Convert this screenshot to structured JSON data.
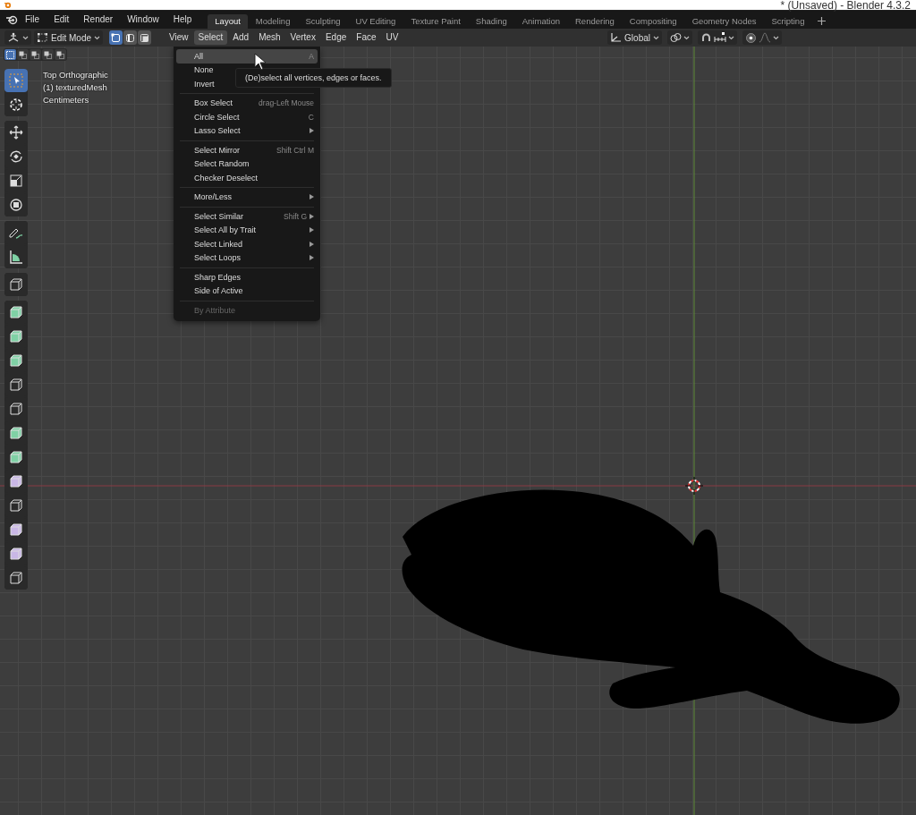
{
  "window": {
    "title": "* (Unsaved) - Blender 4.3.2"
  },
  "menubar": [
    "File",
    "Edit",
    "Render",
    "Window",
    "Help"
  ],
  "workspaces": [
    {
      "label": "Layout",
      "selected": true
    },
    {
      "label": "Modeling",
      "selected": false
    },
    {
      "label": "Sculpting",
      "selected": false
    },
    {
      "label": "UV Editing",
      "selected": false
    },
    {
      "label": "Texture Paint",
      "selected": false
    },
    {
      "label": "Shading",
      "selected": false
    },
    {
      "label": "Animation",
      "selected": false
    },
    {
      "label": "Rendering",
      "selected": false
    },
    {
      "label": "Compositing",
      "selected": false
    },
    {
      "label": "Geometry Nodes",
      "selected": false
    },
    {
      "label": "Scripting",
      "selected": false
    }
  ],
  "header": {
    "mode": "Edit Mode",
    "select_modes": [
      {
        "kind": "vertex",
        "selected": true
      },
      {
        "kind": "edge",
        "selected": false
      },
      {
        "kind": "face",
        "selected": false
      }
    ],
    "menus": [
      {
        "label": "View",
        "selected": false
      },
      {
        "label": "Select",
        "selected": true
      },
      {
        "label": "Add",
        "selected": false
      },
      {
        "label": "Mesh",
        "selected": false
      },
      {
        "label": "Vertex",
        "selected": false
      },
      {
        "label": "Edge",
        "selected": false
      },
      {
        "label": "Face",
        "selected": false
      },
      {
        "label": "UV",
        "selected": false
      }
    ],
    "orientation": "Global"
  },
  "viewport": {
    "overlay": [
      "Top Orthographic",
      "(1) texturedMesh",
      "Centimeters"
    ],
    "box_modes": [
      {
        "kind": "new",
        "selected": true
      },
      {
        "kind": "extend",
        "selected": false
      },
      {
        "kind": "subtract",
        "selected": false
      },
      {
        "kind": "invert",
        "selected": false
      },
      {
        "kind": "intersect",
        "selected": false
      }
    ],
    "tool_groups": [
      [
        {
          "kind": "select",
          "selected": true
        },
        {
          "kind": "cursor",
          "selected": false
        }
      ],
      [
        {
          "kind": "move",
          "selected": false
        },
        {
          "kind": "rotate",
          "selected": false
        },
        {
          "kind": "scale",
          "selected": false
        },
        {
          "kind": "transform",
          "selected": false
        }
      ],
      [
        {
          "kind": "annotate",
          "selected": false
        },
        {
          "kind": "measure",
          "selected": false
        }
      ],
      [
        {
          "kind": "add-cube",
          "selected": false
        }
      ],
      [
        {
          "kind": "extrude",
          "selected": false
        },
        {
          "kind": "inset",
          "selected": false
        },
        {
          "kind": "bevel",
          "selected": false
        },
        {
          "kind": "loop-cut",
          "selected": false
        },
        {
          "kind": "knife",
          "selected": false
        },
        {
          "kind": "poly-build",
          "selected": false
        },
        {
          "kind": "spin",
          "selected": false
        },
        {
          "kind": "smooth",
          "selected": false
        },
        {
          "kind": "edge-slide",
          "selected": false
        },
        {
          "kind": "shrink",
          "selected": false
        },
        {
          "kind": "shear",
          "selected": false
        },
        {
          "kind": "rip",
          "selected": false
        }
      ]
    ]
  },
  "select_menu": {
    "sections": [
      [
        {
          "label": "All",
          "shortcut": "A",
          "submenu": false,
          "disabled": false,
          "selected": true
        },
        {
          "label": "None",
          "submenu": false,
          "disabled": false,
          "selected": false
        },
        {
          "label": "Invert",
          "submenu": false,
          "disabled": false,
          "selected": false
        }
      ],
      [
        {
          "label": "Box Select",
          "shortcut": "drag-Left Mouse",
          "submenu": false,
          "disabled": false,
          "selected": false
        },
        {
          "label": "Circle Select",
          "shortcut": "C",
          "submenu": false,
          "disabled": false,
          "selected": false
        },
        {
          "label": "Lasso Select",
          "submenu": true,
          "disabled": false,
          "selected": false
        }
      ],
      [
        {
          "label": "Select Mirror",
          "shortcut": "Shift Ctrl M",
          "submenu": false,
          "disabled": false,
          "selected": false
        },
        {
          "label": "Select Random",
          "submenu": false,
          "disabled": false,
          "selected": false
        },
        {
          "label": "Checker Deselect",
          "submenu": false,
          "disabled": false,
          "selected": false
        }
      ],
      [
        {
          "label": "More/Less",
          "submenu": true,
          "disabled": false,
          "selected": false
        }
      ],
      [
        {
          "label": "Select Similar",
          "shortcut": "Shift G",
          "submenu": true,
          "disabled": false,
          "selected": false
        },
        {
          "label": "Select All by Trait",
          "submenu": true,
          "disabled": false,
          "selected": false
        },
        {
          "label": "Select Linked",
          "submenu": true,
          "disabled": false,
          "selected": false
        },
        {
          "label": "Select Loops",
          "submenu": true,
          "disabled": false,
          "selected": false
        }
      ],
      [
        {
          "label": "Sharp Edges",
          "submenu": false,
          "disabled": false,
          "selected": false
        },
        {
          "label": "Side of Active",
          "submenu": false,
          "disabled": false,
          "selected": false
        }
      ],
      [
        {
          "label": "By Attribute",
          "submenu": false,
          "disabled": true,
          "selected": false
        }
      ]
    ],
    "tooltip": "(De)select all vertices, edges or faces."
  }
}
